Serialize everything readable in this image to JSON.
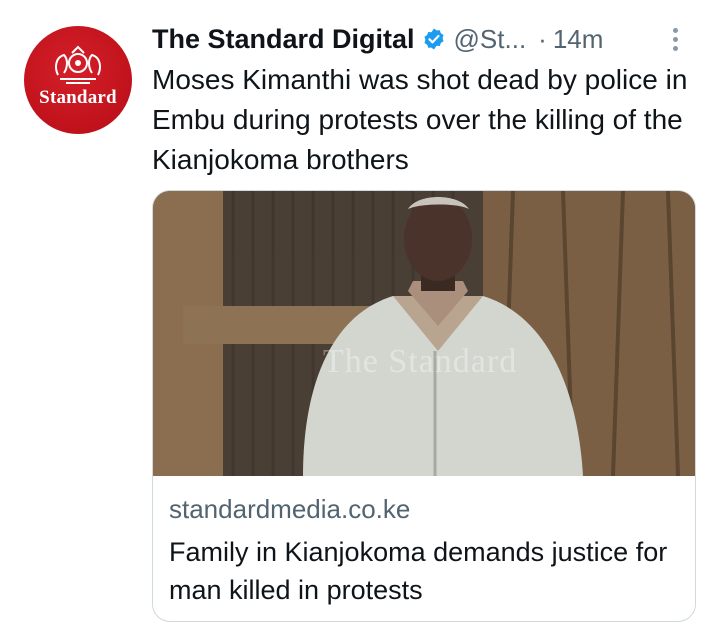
{
  "account": {
    "avatar_brand": "Standard",
    "display_name": "The Standard Digital",
    "handle": "@St...",
    "separator": "·",
    "time": "14m",
    "verified_icon": "verified-badge-icon"
  },
  "tweet": {
    "text": "Moses Kimanthi was shot dead by police in Embu during protests over the killing of the Kianjokoma brothers"
  },
  "card": {
    "image_watermark": "The Standard",
    "domain": "standardmedia.co.ke",
    "title": "Family in Kianjokoma demands justice for man killed in protests"
  },
  "colors": {
    "brand_red": "#c0121c",
    "verified_blue": "#1d9bf0",
    "muted_text": "#536471"
  }
}
